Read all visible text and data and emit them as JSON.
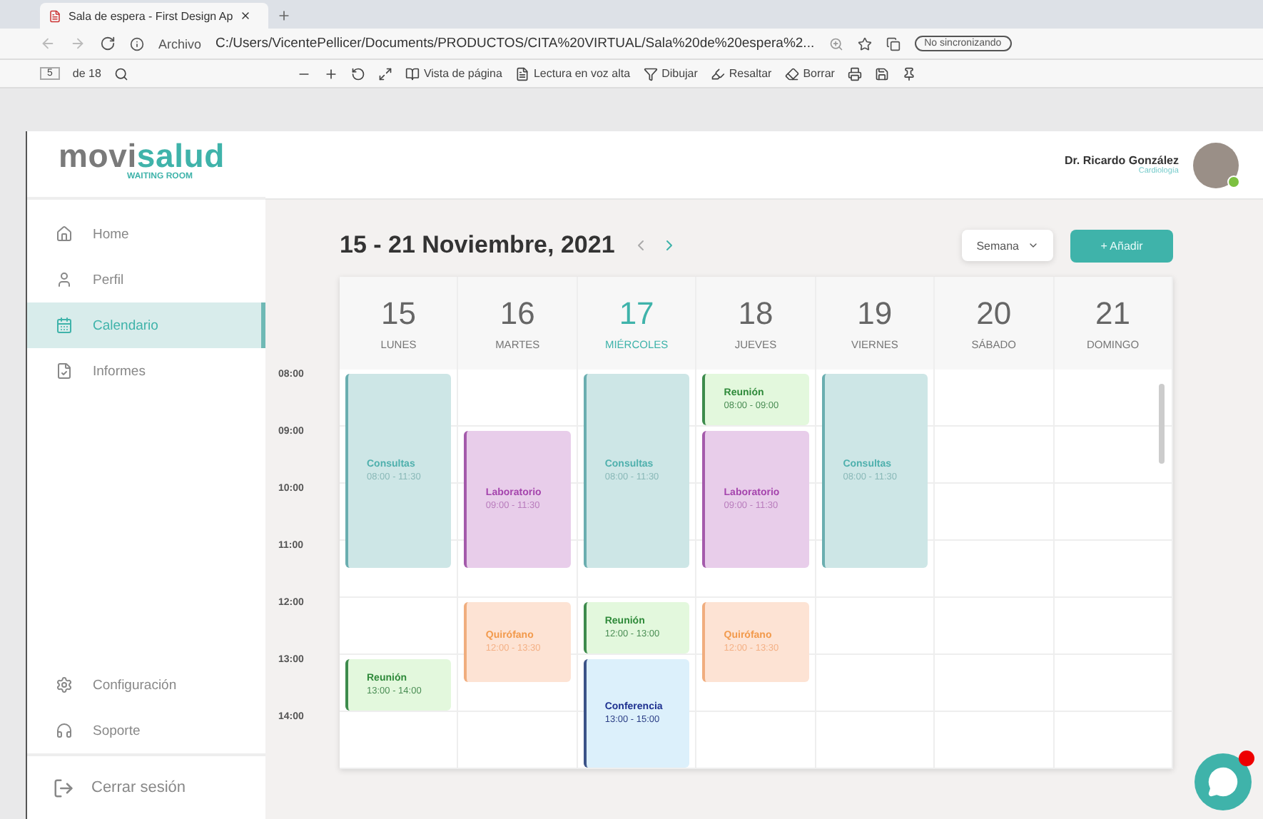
{
  "browser": {
    "tab_title": "Sala de espera - First Design Ap",
    "address_prefix": "Archivo",
    "url": "C:/Users/VicentePellicer/Documents/PRODUCTOS/CITA%20VIRTUAL/Sala%20de%20espera%2...",
    "profile_status": "No sincronizando"
  },
  "pdf_toolbar": {
    "page": "5",
    "page_count": "de 18",
    "items": [
      {
        "kind": "page-view",
        "label": "Vista de página"
      },
      {
        "kind": "read-aloud",
        "label": "Lectura en voz alta"
      },
      {
        "kind": "draw",
        "label": "Dibujar"
      },
      {
        "kind": "highlight",
        "label": "Resaltar"
      },
      {
        "kind": "erase",
        "label": "Borrar"
      }
    ]
  },
  "logo": {
    "part_1": "movi",
    "part_2": "salud",
    "subtitle": "WAITING ROOM"
  },
  "user": {
    "name": "Dr. Ricardo González",
    "role": "Cardiología",
    "online": true
  },
  "sidebar": {
    "items": [
      {
        "kind": "home",
        "label": "Home",
        "selected": false
      },
      {
        "kind": "profile",
        "label": "Perfil",
        "selected": false
      },
      {
        "kind": "calendar",
        "label": "Calendario",
        "selected": true
      },
      {
        "kind": "reports",
        "label": "Informes",
        "selected": false
      }
    ],
    "bottom_items": [
      {
        "kind": "settings",
        "label": "Configuración"
      },
      {
        "kind": "support",
        "label": "Soporte"
      }
    ],
    "logout": "Cerrar sesión"
  },
  "calendar": {
    "title": "15 - 21 Noviembre, 2021",
    "view": "Semana",
    "add_button": "+ Añadir",
    "hours": [
      "08:00",
      "09:00",
      "10:00",
      "11:00",
      "12:00",
      "13:00",
      "14:00"
    ],
    "days": [
      {
        "number": "15",
        "name": "LUNES",
        "selected": false,
        "events": [
          {
            "kind": "consultas",
            "title": "Consultas",
            "time": "08:00 - 11:30"
          },
          {
            "kind": "reunion",
            "title": "Reunión",
            "time": "13:00 - 14:00"
          }
        ]
      },
      {
        "number": "16",
        "name": "MARTES",
        "selected": false,
        "events": [
          {
            "kind": "laboratorio",
            "title": "Laboratorio",
            "time": "09:00 - 11:30"
          },
          {
            "kind": "quirofano",
            "title": "Quirófano",
            "time": "12:00 - 13:30"
          }
        ]
      },
      {
        "number": "17",
        "name": "MIÉRCOLES",
        "selected": true,
        "events": [
          {
            "kind": "consultas",
            "title": "Consultas",
            "time": "08:00 - 11:30"
          },
          {
            "kind": "reunion",
            "title": "Reunión",
            "time": "12:00 - 13:00"
          },
          {
            "kind": "conferencia",
            "title": "Conferencia",
            "time": "13:00 - 15:00"
          }
        ]
      },
      {
        "number": "18",
        "name": "JUEVES",
        "selected": false,
        "events": [
          {
            "kind": "reunion",
            "title": "Reunión",
            "time": "08:00 - 09:00"
          },
          {
            "kind": "laboratorio",
            "title": "Laboratorio",
            "time": "09:00 - 11:30"
          },
          {
            "kind": "quirofano",
            "title": "Quirófano",
            "time": "12:00 - 13:30"
          }
        ]
      },
      {
        "number": "19",
        "name": "VIERNES",
        "selected": false,
        "events": [
          {
            "kind": "consultas",
            "title": "Consultas",
            "time": "08:00 - 11:30"
          }
        ]
      },
      {
        "number": "20",
        "name": "SÁBADO",
        "selected": false
      },
      {
        "number": "21",
        "name": "DOMINGO",
        "selected": false
      }
    ]
  },
  "chat": {
    "unread": true
  }
}
